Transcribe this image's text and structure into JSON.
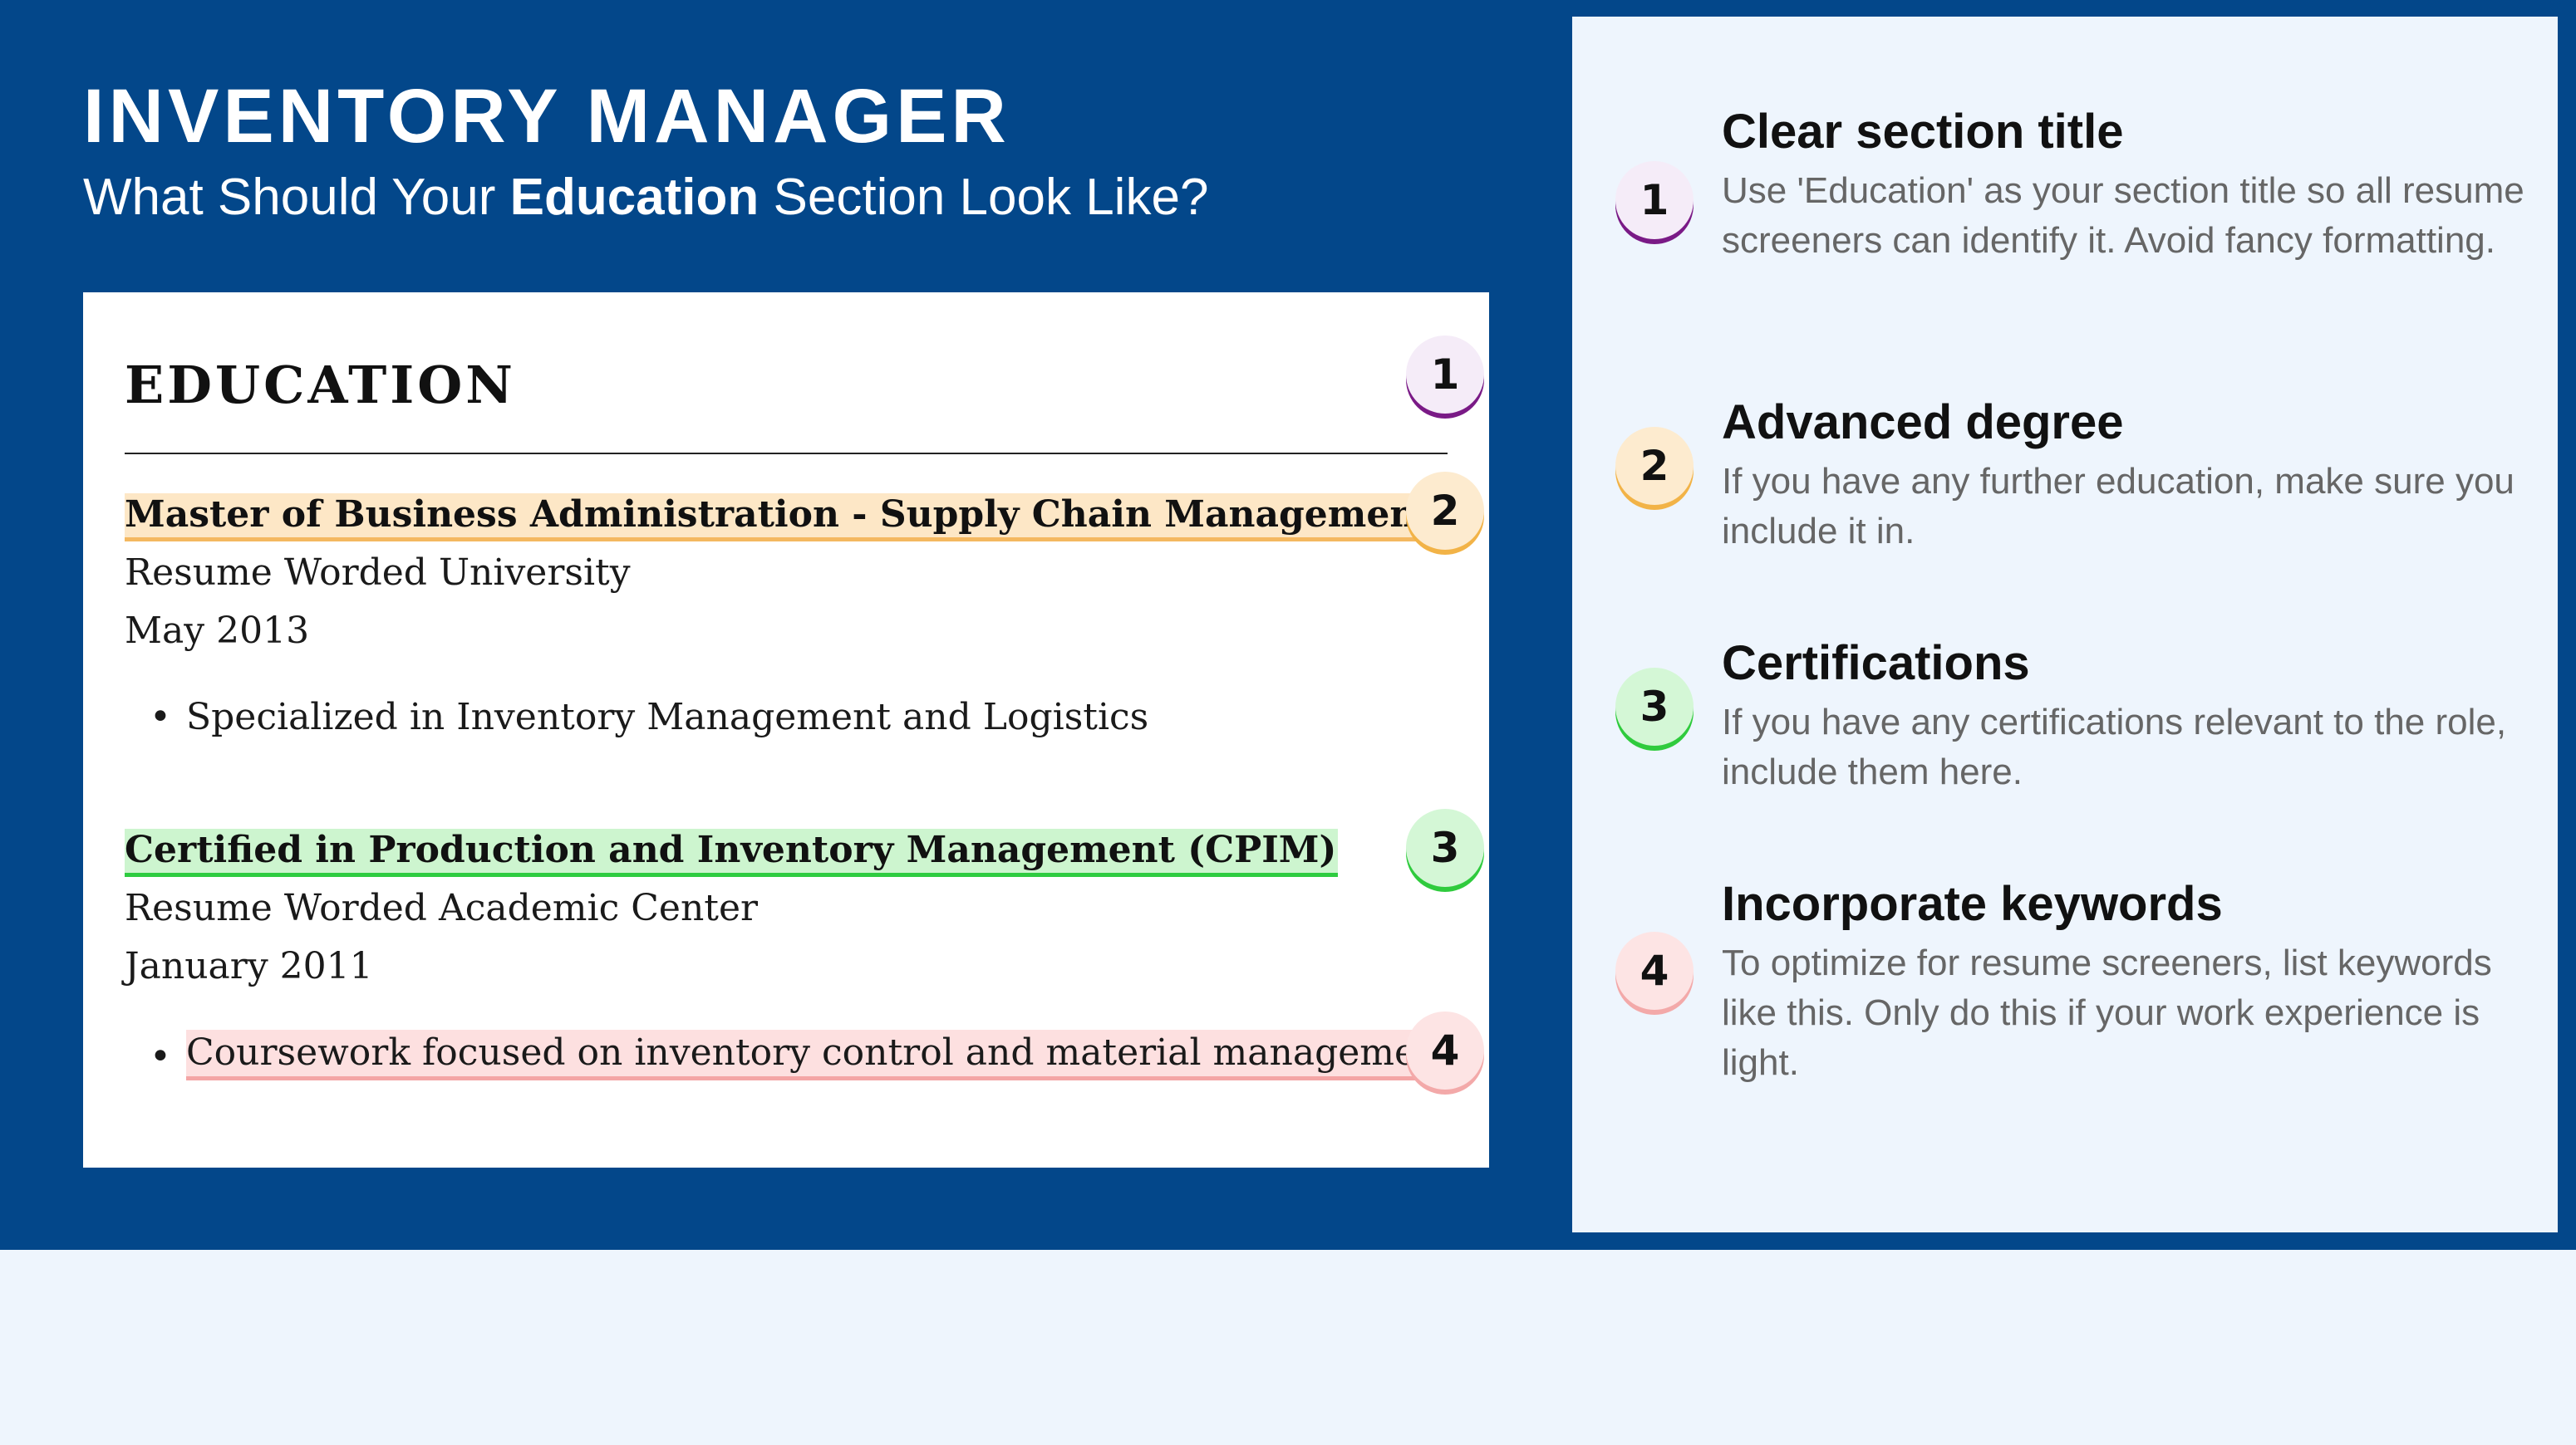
{
  "header": {
    "title": "INVENTORY MANAGER",
    "subtitle_before": "What Should Your ",
    "subtitle_bold": "Education",
    "subtitle_after": " Section Look Like?"
  },
  "resume": {
    "section_heading": "EDUCATION",
    "entries": [
      {
        "degree": "Master of Business Administration - Supply Chain Management",
        "school": "Resume Worded University",
        "date": "May 2013",
        "bullet": "Specialized in Inventory Management and Logistics"
      },
      {
        "degree": "Certified in Production and Inventory Management (CPIM)",
        "school": "Resume Worded Academic Center",
        "date": "January 2011",
        "bullet": "Coursework focused on inventory control and material managemer"
      }
    ],
    "badges": [
      "1",
      "2",
      "3",
      "4"
    ]
  },
  "tips": [
    {
      "number": "1",
      "title": "Clear section title",
      "body": "Use 'Education' as your section title so all resume screeners can identify it. Avoid fancy formatting."
    },
    {
      "number": "2",
      "title": "Advanced degree",
      "body": "If you have any further education, make sure you include it in."
    },
    {
      "number": "3",
      "title": "Certifications",
      "body": "If you have any certifications relevant to the role, include them here."
    },
    {
      "number": "4",
      "title": "Incorporate keywords",
      "body": "To optimize for resume screeners, list keywords like this. Only do this if your work experience is light."
    }
  ],
  "colors": {
    "banner": "#03478a",
    "panel": "#eef5fd",
    "badge1": "#7a1a86",
    "badge2": "#f2b347",
    "badge3": "#2fcb3d",
    "badge4": "#f3a9a9"
  }
}
